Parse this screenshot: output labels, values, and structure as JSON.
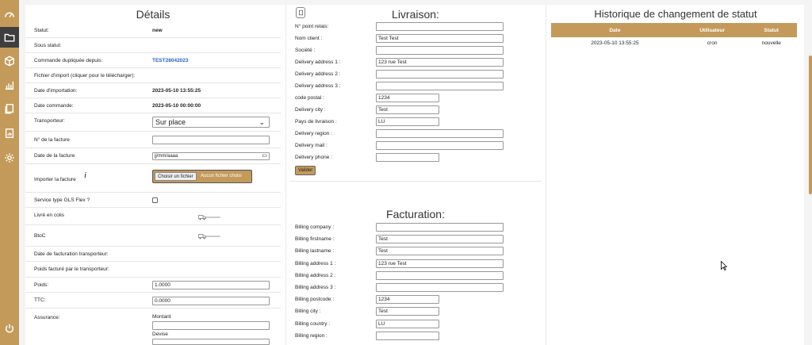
{
  "sidebar": {
    "icons": [
      "dashboard-icon",
      "folder-icon",
      "box-icon",
      "chart-icon",
      "copy-icon",
      "report-icon",
      "gear-icon",
      "power-icon"
    ]
  },
  "details": {
    "title": "Détails",
    "statut_label": "Statut:",
    "statut_value": "new",
    "sous_statut_label": "Sous statut:",
    "dup_label": "Commande dupliquée depuis:",
    "dup_value": "TEST28042023",
    "import_file_label": "Fichier d'import (cliquer pour le télécharger):",
    "import_date_label": "Date d'importation:",
    "import_date_value": "2023-05-10 13:55:25",
    "order_date_label": "Date commande:",
    "order_date_value": "2023-05-10 00:00:00",
    "carrier_label": "Transporteur:",
    "carrier_value": "Sur place",
    "invoice_no_label": "N° de la facture",
    "invoice_date_label": "Date de la facture",
    "invoice_date_placeholder": "jj/mm/aaaa",
    "import_invoice_label": "Importer la facture",
    "info_glyph": "i",
    "file_button": "Choisir un fichier",
    "file_none": "Aucun fichier choisi",
    "gls_label": "Service type GLS Flex ?",
    "colis_label": "Livré en colis",
    "btoc_label": "BtoC",
    "carrier_invoice_date_label": "Date de facturation transporteur:",
    "carrier_weight_label": "Poids facturé par le transporteur:",
    "poids_label": "Poids:",
    "poids_value": "1.0000",
    "ttc_label": "TTC:",
    "ttc_value": "0.0000",
    "assurance_label": "Assurance:",
    "montant_label": "Montant",
    "devise_label": "Devise"
  },
  "livraison": {
    "title": "Livraison:",
    "fields": [
      {
        "label": "N° point relais:",
        "value": ""
      },
      {
        "label": "Nom client :",
        "value": "Test Test"
      },
      {
        "label": "Société :",
        "value": ""
      },
      {
        "label": "Delivery address 1 :",
        "value": "123 rue Test"
      },
      {
        "label": "Delivery address 2 :",
        "value": ""
      },
      {
        "label": "Delivery address 3 :",
        "value": ""
      },
      {
        "label": "code postal :",
        "value": "1234"
      },
      {
        "label": "Delivery city :",
        "value": "Test"
      },
      {
        "label": "Pays de livraison :",
        "value": "LU"
      },
      {
        "label": "Delivery region :",
        "value": ""
      },
      {
        "label": "Delivery mail :",
        "value": ""
      },
      {
        "label": "Delivery phone :",
        "value": ""
      }
    ],
    "validate": "Valider"
  },
  "facturation": {
    "title": "Facturation:",
    "fields": [
      {
        "label": "Billing company :",
        "value": ""
      },
      {
        "label": "Billing firstname :",
        "value": "Test"
      },
      {
        "label": "Billing lastname :",
        "value": "Test"
      },
      {
        "label": "Billing address 1 :",
        "value": "123 rue Test"
      },
      {
        "label": "Billing address 2 :",
        "value": ""
      },
      {
        "label": "Billing address 3 :",
        "value": ""
      },
      {
        "label": "Billing postcode :",
        "value": "1234"
      },
      {
        "label": "Billing city :",
        "value": "Test"
      },
      {
        "label": "Billing country :",
        "value": "LU"
      },
      {
        "label": "Billing region :",
        "value": ""
      }
    ]
  },
  "historique": {
    "title": "Historique de changement de statut",
    "headers": [
      "Date",
      "Utilisateur",
      "Statut"
    ],
    "rows": [
      [
        "2023-05-10 13:55:25",
        "cron",
        "nouvelle"
      ]
    ]
  }
}
